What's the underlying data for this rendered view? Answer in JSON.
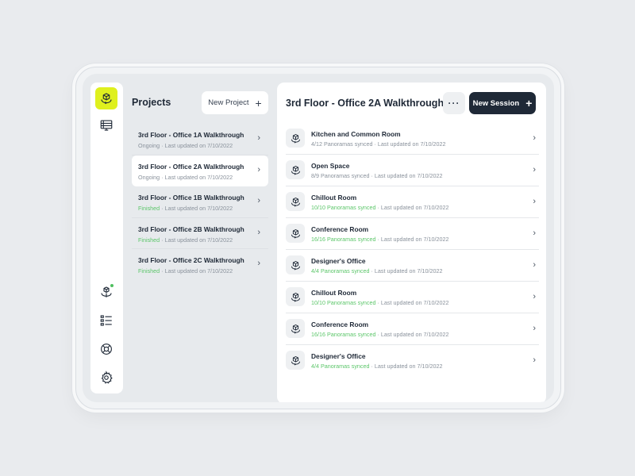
{
  "sidebar": {
    "items": [
      {
        "icon": "cube-rotate-icon",
        "active": true
      },
      {
        "icon": "monitor-list-icon",
        "active": false
      }
    ],
    "bottom_items": [
      {
        "icon": "device-sync-icon",
        "badge_color": "#4fbf5f"
      },
      {
        "icon": "checklist-icon"
      },
      {
        "icon": "lifebuoy-icon"
      },
      {
        "icon": "gear-icon"
      }
    ]
  },
  "projects": {
    "title": "Projects",
    "new_button": "New Project",
    "items": [
      {
        "name": "3rd Floor - Office 1A Walkthrough",
        "status": "Ongoing",
        "updated": "Last updated on 7/10/2022"
      },
      {
        "name": "3rd Floor - Office 2A Walkthrough",
        "status": "Ongoing",
        "updated": "Last updated on 7/10/2022"
      },
      {
        "name": "3rd Floor - Office 1B Walkthrough",
        "status": "Finished",
        "updated": "Last updated on 7/10/2022"
      },
      {
        "name": "3rd Floor - Office 2B Walkthrough",
        "status": "Finished",
        "updated": "Last updated on 7/10/2022"
      },
      {
        "name": "3rd Floor - Office 2C Walkthrough",
        "status": "Finished",
        "updated": "Last updated on 7/10/2022"
      }
    ],
    "separator": "·"
  },
  "panel": {
    "title": "3rd Floor - Office 2A Walkthrough",
    "more_label": "···",
    "new_session": "New Session",
    "sessions": [
      {
        "name": "Kitchen and Common Room",
        "panoramas": "4/12 Panoramas synced",
        "complete": false,
        "updated": "Last updated on 7/10/2022"
      },
      {
        "name": "Open Space",
        "panoramas": "8/9 Panoramas synced",
        "complete": false,
        "updated": "Last updated on 7/10/2022"
      },
      {
        "name": "Chillout Room",
        "panoramas": "10/10 Panoramas synced",
        "complete": true,
        "updated": "Last updated on 7/10/2022"
      },
      {
        "name": "Conference Room",
        "panoramas": "16/16 Panoramas synced",
        "complete": true,
        "updated": "Last updated on 7/10/2022"
      },
      {
        "name": "Designer's Office",
        "panoramas": "4/4 Panoramas synced",
        "complete": true,
        "updated": "Last updated on 7/10/2022"
      },
      {
        "name": "Chillout Room",
        "panoramas": "10/10 Panoramas synced",
        "complete": true,
        "updated": "Last updated on 7/10/2022"
      },
      {
        "name": "Conference Room",
        "panoramas": "16/16 Panoramas synced",
        "complete": true,
        "updated": "Last updated on 7/10/2022"
      },
      {
        "name": "Designer's Office",
        "panoramas": "4/4 Panoramas synced",
        "complete": true,
        "updated": "Last updated on 7/10/2022"
      }
    ]
  },
  "colors": {
    "accent": "#dff01e",
    "success": "#5cc66a",
    "dark_button": "#1f2937"
  }
}
